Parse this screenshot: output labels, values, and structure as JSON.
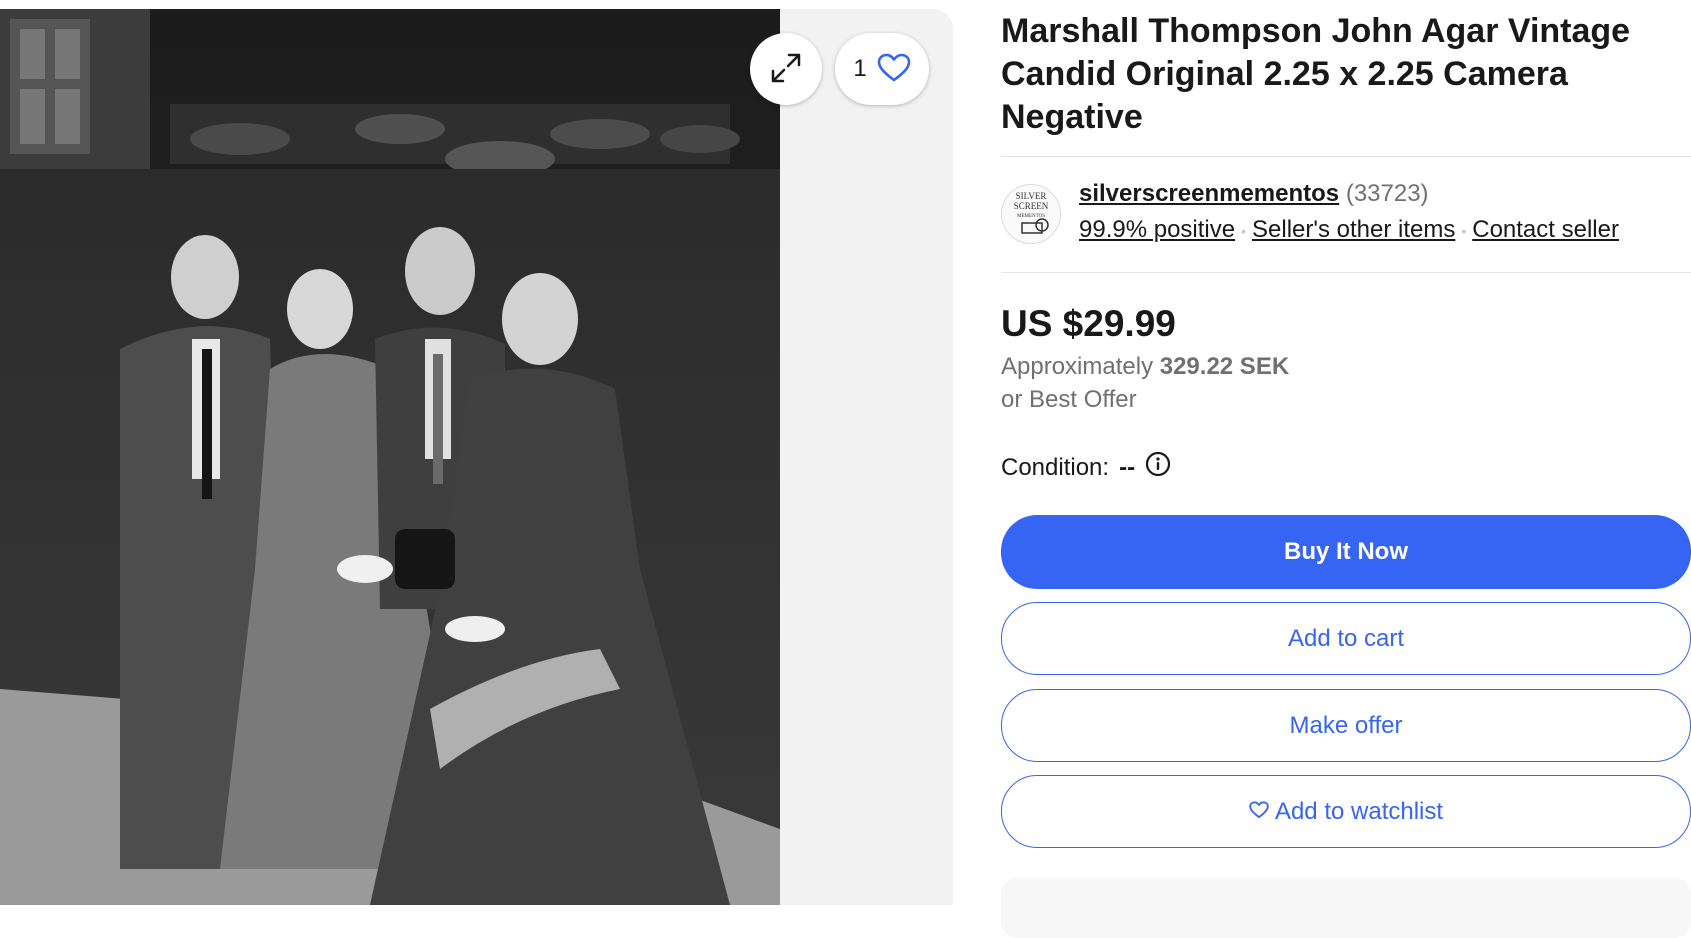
{
  "listing": {
    "title": "Marshall Thompson John Agar Vintage Candid Original 2.25 x 2.25 Camera Negative"
  },
  "gallery": {
    "expand_icon": "expand-arrows-icon",
    "watch_count": "1",
    "heart_icon": "heart-outline-icon"
  },
  "seller": {
    "avatar_text": "SILVER SCREEN MEMENTOS",
    "name": "silverscreenmementos",
    "feedback_count": "(33723)",
    "positive": "99.9% positive",
    "other_items": "Seller's other items",
    "contact": "Contact seller"
  },
  "pricing": {
    "price": "US $29.99",
    "approx_label": "Approximately",
    "approx_value": "329.22 SEK",
    "best_offer": "or Best Offer"
  },
  "condition": {
    "label": "Condition:",
    "value": "--",
    "info_icon": "info-circle-icon"
  },
  "actions": {
    "buy_now": "Buy It Now",
    "add_to_cart": "Add to cart",
    "make_offer": "Make offer",
    "add_to_watchlist": "Add to watchlist"
  },
  "colors": {
    "primary": "#3665f3",
    "text": "#191919",
    "secondary_text": "#707070"
  }
}
